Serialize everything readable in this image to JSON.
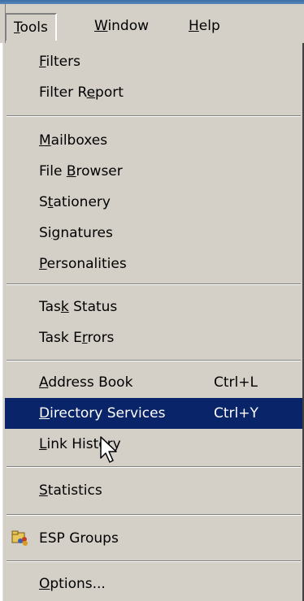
{
  "menubar": {
    "tools": {
      "pre": "",
      "key": "T",
      "post": "ools"
    },
    "window": {
      "pre": "",
      "key": "W",
      "post": "indow"
    },
    "help": {
      "pre": "",
      "key": "H",
      "post": "elp"
    }
  },
  "menu": {
    "filters": {
      "pre": "",
      "key": "F",
      "post": "ilters"
    },
    "filter_report": {
      "pre": "Filter R",
      "key": "e",
      "post": "port"
    },
    "mailboxes": {
      "pre": "",
      "key": "M",
      "post": "ailboxes"
    },
    "file_browser": {
      "pre": "File ",
      "key": "B",
      "post": "rowser"
    },
    "stationery": {
      "pre": "S",
      "key": "t",
      "post": "ationery"
    },
    "signatures": {
      "pre": "Si",
      "key": "g",
      "post": "natures"
    },
    "personalities": {
      "pre": "",
      "key": "P",
      "post": "ersonalities"
    },
    "task_status": {
      "pre": "Tas",
      "key": "k",
      "post": " Status"
    },
    "task_errors": {
      "pre": "Task E",
      "key": "r",
      "post": "rors"
    },
    "address_book": {
      "pre": "",
      "key": "A",
      "post": "ddress Book",
      "shortcut": "Ctrl+L"
    },
    "directory_services": {
      "pre": "",
      "key": "D",
      "post": "irectory Services",
      "shortcut": "Ctrl+Y"
    },
    "link_history": {
      "pre": "",
      "key": "L",
      "post": "ink History"
    },
    "statistics": {
      "pre": "",
      "key": "S",
      "post": "tatistics"
    },
    "esp_groups": {
      "label": "ESP Groups",
      "icon": "esp-groups-icon"
    },
    "options": {
      "pre": "",
      "key": "O",
      "post": "ptions..."
    }
  },
  "colors": {
    "highlight_bg": "#0a246a",
    "menu_bg": "#d4d0c8"
  }
}
